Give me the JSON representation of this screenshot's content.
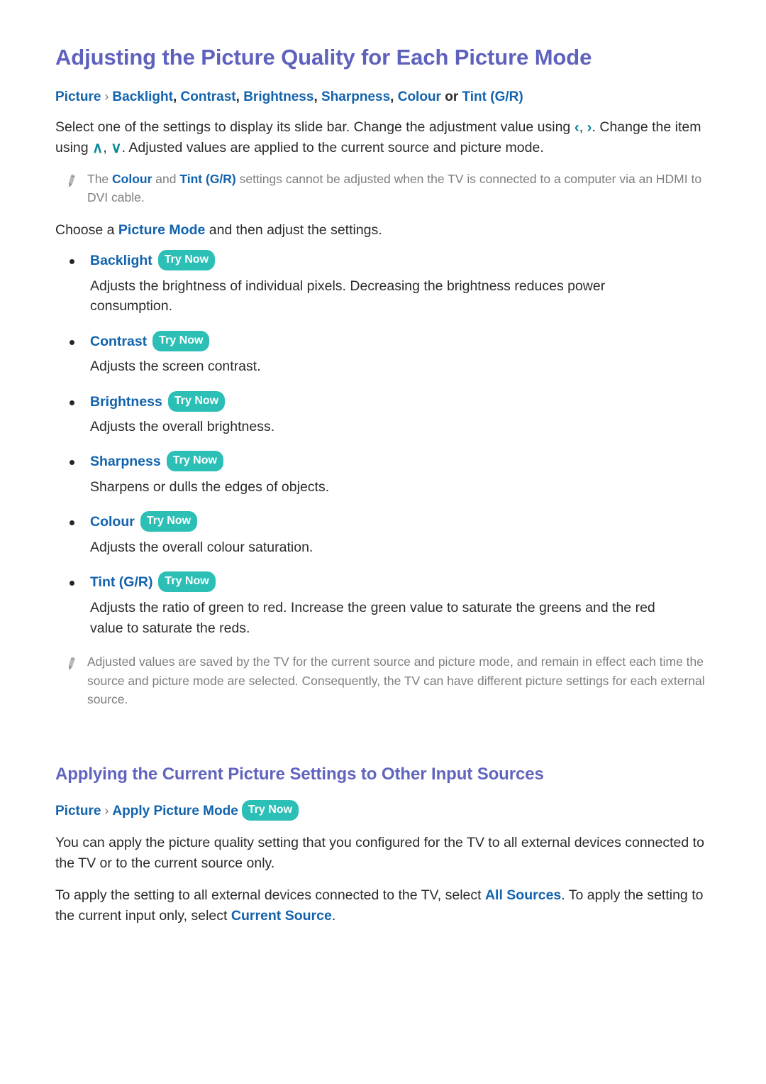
{
  "colors": {
    "heading": "#5f62bd",
    "link": "#1263ad",
    "badge": "#2cbfb6",
    "body": "#2b2b2b",
    "note": "#7e7e7e",
    "chevron": "#0d8a9c"
  },
  "section1": {
    "heading": "Adjusting the Picture Quality for Each Picture Mode",
    "breadcrumb": {
      "root": "Picture",
      "separator": "›",
      "items": [
        "Backlight",
        "Contrast",
        "Brightness",
        "Sharpness",
        "Colour"
      ],
      "or": "or",
      "last": "Tint (G/R)"
    },
    "intro_part1": "Select one of the settings to display its slide bar. Change the adjustment value using",
    "intro_chevron_left": "‹",
    "intro_chevron_comma": ",",
    "intro_chevron_right": "›",
    "intro_part2": ". Change the item using",
    "intro_chevron_up": "∧",
    "intro_chevron_down": "∨",
    "intro_part3": ". Adjusted values are applied to the current source and picture mode.",
    "note": {
      "icon": "pencil-icon",
      "text_a": "The",
      "link_1": "Colour",
      "text_b": "and",
      "link_2": "Tint (G/R)",
      "text_c": "settings cannot be adjusted when the TV is connected to a computer via an HDMI to DVI cable."
    },
    "choose_text_a": "Choose a",
    "choose_link": "Picture Mode",
    "choose_text_b": "and then adjust the settings.",
    "try_now_label": "Try Now",
    "settings": [
      {
        "name": "Backlight",
        "badge": "Try Now",
        "description": "Adjusts the brightness of individual pixels. Decreasing the brightness reduces power consumption."
      },
      {
        "name": "Contrast",
        "badge": "Try Now",
        "description": "Adjusts the screen contrast."
      },
      {
        "name": "Brightness",
        "badge": "Try Now",
        "description": "Adjusts the overall brightness."
      },
      {
        "name": "Sharpness",
        "badge": "Try Now",
        "description": "Sharpens or dulls the edges of objects."
      },
      {
        "name": "Colour",
        "badge": "Try Now",
        "description": "Adjusts the overall colour saturation."
      },
      {
        "name": "Tint (G/R)",
        "badge": "Try Now",
        "description": "Adjusts the ratio of green to red. Increase the green value to saturate the greens and the red value to saturate the reds."
      }
    ],
    "note2": {
      "icon": "pencil-icon",
      "text": "Adjusted values are saved by the TV for the current source and picture mode, and remain in effect each time the source and picture mode are selected. Consequently, the TV can have different picture settings for each external source."
    }
  },
  "section2": {
    "heading": "Applying the Current Picture Settings to Other Input Sources",
    "breadcrumb": {
      "root": "Picture",
      "separator": "›",
      "item": "Apply Picture Mode",
      "badge": "Try Now"
    },
    "paragraph_1": "You can apply the picture quality setting that you configured for the TV to all external devices connected to the TV or to the current source only.",
    "paragraph_2_a": "To apply the setting to all external devices connected to the TV, select",
    "paragraph_2_link_1": "All Sources",
    "paragraph_2_b": ". To apply the setting to the current input only, select",
    "paragraph_2_link_2": "Current Source",
    "paragraph_2_c": "."
  }
}
